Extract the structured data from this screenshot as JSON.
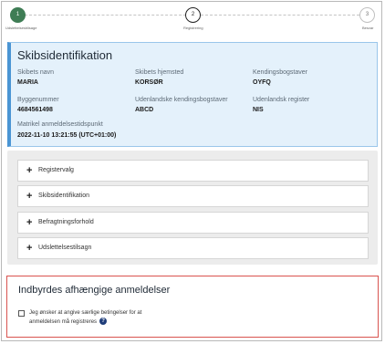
{
  "stepper": {
    "steps": [
      {
        "number": "1",
        "label": "Udslettelsesblisage",
        "state": "done"
      },
      {
        "number": "2",
        "label": "Registrering",
        "state": "active"
      },
      {
        "number": "3",
        "label": "Besvar",
        "state": "todo"
      }
    ]
  },
  "identification": {
    "title": "Skibsidentifikation",
    "fields": [
      {
        "label": "Skibets navn",
        "value": "MARIA"
      },
      {
        "label": "Skibets hjemsted",
        "value": "KORSØR"
      },
      {
        "label": "Kendingsbogstaver",
        "value": "OYFQ"
      },
      {
        "label": "Byggenummer",
        "value": "4684561498"
      },
      {
        "label": "Udenlandske kendingsbogstaver",
        "value": "ABCD"
      },
      {
        "label": "Udenlandsk register",
        "value": "NIS"
      },
      {
        "label": "Matrikel anmeldelsestidspunkt",
        "value": "2022-11-10 13:21:55 (UTC+01:00)"
      }
    ]
  },
  "accordion": {
    "items": [
      {
        "label": "Registervalg"
      },
      {
        "label": "Skibsidentifikation"
      },
      {
        "label": "Befragtningsforhold"
      },
      {
        "label": "Udslettelsestilsagn"
      }
    ]
  },
  "dependent": {
    "title": "Indbyrdes afhængige anmeldelser",
    "checkbox_line1": "Jeg ønsker at angive særlige betingelser for at",
    "checkbox_line2": "anmeldelsen må registreres",
    "help_glyph": "?"
  },
  "colors": {
    "step_done": "#3f7d55",
    "panel_bg": "#e4f1fb",
    "panel_accent": "#4a95d4",
    "alert_border": "#d9534f",
    "help_icon": "#1f3d7a"
  }
}
